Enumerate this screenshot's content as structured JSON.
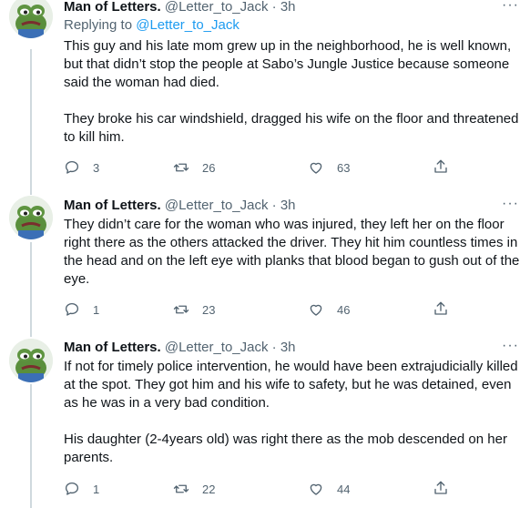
{
  "tweets": [
    {
      "author": "Man of Letters.",
      "handle": "@Letter_to_Jack",
      "separator": "·",
      "time": "3h",
      "replying_prefix": "Replying to",
      "replying_handle": "@Letter_to_Jack",
      "text": "This guy and his late mom grew up in the neighborhood, he is well known, but that didn’t stop the people at Sabo’s Jungle Justice because someone said the woman had died.\n\nThey broke his car windshield, dragged his wife on the floor and threatened to kill him.",
      "replies": "3",
      "retweets": "26",
      "likes": "63"
    },
    {
      "author": "Man of Letters.",
      "handle": "@Letter_to_Jack",
      "separator": "·",
      "time": "3h",
      "text": "They didn’t care for the woman who was injured, they left her on the floor right there as the others attacked the driver. They hit him countless times in the head and on the left eye with planks that blood began to gush out of the eye.",
      "replies": "1",
      "retweets": "23",
      "likes": "46"
    },
    {
      "author": "Man of Letters.",
      "handle": "@Letter_to_Jack",
      "separator": "·",
      "time": "3h",
      "text": "If not for timely police intervention, he would have been extrajudicially killed at the spot. They got him and his wife to safety, but he was detained, even as he was in a very bad condition.\n\nHis daughter (2-4years old) was right there as the mob descended on her parents.",
      "replies": "1",
      "retweets": "22",
      "likes": "44"
    }
  ],
  "more_label": "···",
  "icons": {
    "avatar": "frog-avatar-icon",
    "reply": "reply-icon",
    "retweet": "retweet-icon",
    "like": "heart-icon",
    "share": "share-icon",
    "more": "more-icon"
  },
  "colors": {
    "text": "#0f1419",
    "muted": "#536471",
    "link": "#1d9bf0",
    "thread_line": "#cfd9de"
  }
}
